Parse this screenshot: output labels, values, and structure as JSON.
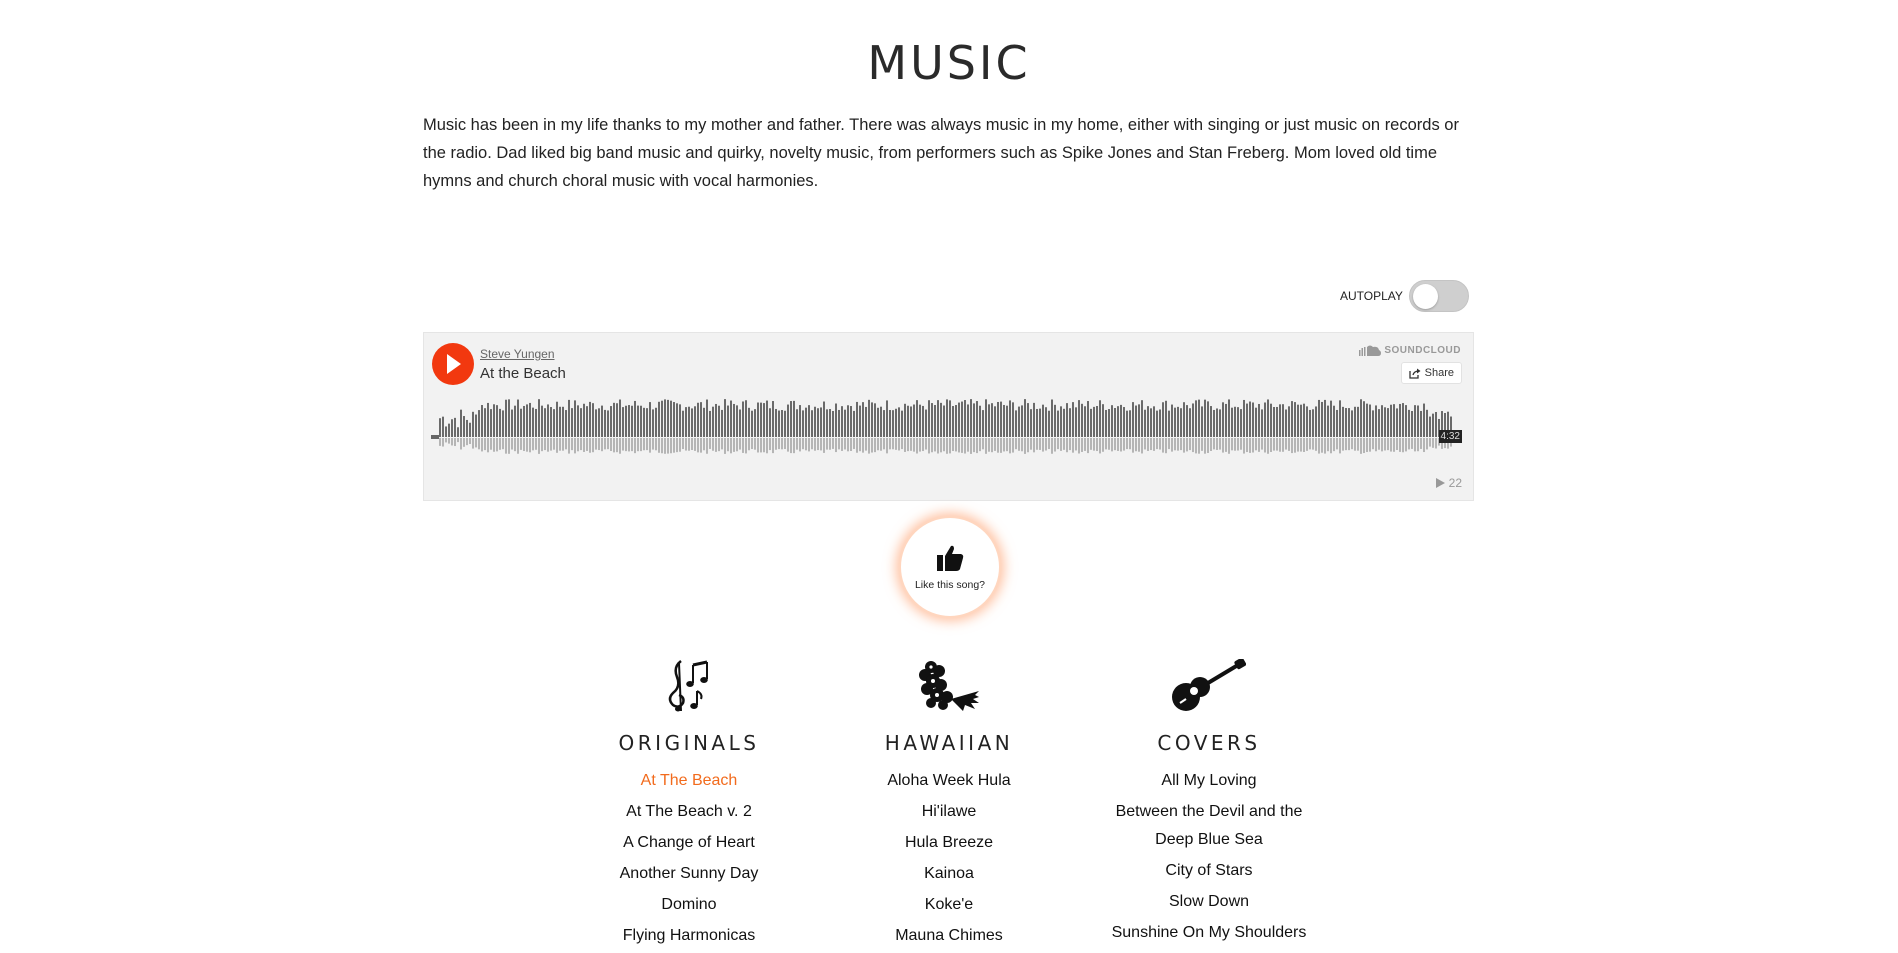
{
  "page": {
    "title": "MUSIC",
    "intro": "Music has been in my life thanks to my mother and father. There was always music in my home, either with singing or just music on records or the radio. Dad liked big band music and quirky, novelty music, from performers such as Spike Jones and Stan Freberg. Mom loved old time hymns and church choral music with vocal harmonies."
  },
  "autoplay": {
    "label": "AUTOPLAY",
    "enabled": false
  },
  "player": {
    "artist": "Steve Yungen",
    "track": "At the Beach",
    "brand": "SOUNDCLOUD",
    "share_label": "Share",
    "duration": "4:32",
    "plays": "22",
    "accent_color": "#f2380f",
    "play_icon": "play-icon"
  },
  "like": {
    "label": "Like this song?",
    "icon": "thumbs-up-icon"
  },
  "categories": [
    {
      "title": "ORIGINALS",
      "icon": "music-notes-icon",
      "songs": [
        "At The Beach",
        "At The Beach v. 2",
        "A Change of Heart",
        "Another Sunny Day",
        "Domino",
        "Flying Harmonicas"
      ],
      "active_index": 0
    },
    {
      "title": "HAWAIIAN",
      "icon": "hibiscus-flower-icon",
      "songs": [
        "Aloha Week Hula",
        "Hi'ilawe",
        "Hula Breeze",
        "Kainoa",
        "Koke'e",
        "Mauna Chimes"
      ]
    },
    {
      "title": "COVERS",
      "icon": "guitar-icon",
      "songs": [
        "All My Loving",
        "Between the Devil and the Deep Blue Sea",
        "City of Stars",
        "Slow Down",
        "Sunshine On My Shoulders"
      ]
    }
  ],
  "colors": {
    "active_song": "#f26b1d"
  }
}
